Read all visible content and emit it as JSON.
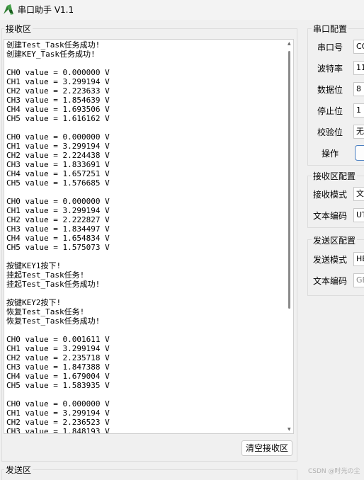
{
  "window": {
    "title": "串口助手 V1.1"
  },
  "receive": {
    "title": "接收区",
    "clear_button": "清空接收区",
    "log_lines": [
      "创建Test_Task任务成功!",
      "创建KEY_Task任务成功!",
      "",
      "CH0 value = 0.000000 V",
      "CH1 value = 3.299194 V",
      "CH2 value = 2.223633 V",
      "CH3 value = 1.854639 V",
      "CH4 value = 1.693506 V",
      "CH5 value = 1.616162 V",
      "",
      "CH0 value = 0.000000 V",
      "CH1 value = 3.299194 V",
      "CH2 value = 2.224438 V",
      "CH3 value = 1.833691 V",
      "CH4 value = 1.657251 V",
      "CH5 value = 1.576685 V",
      "",
      "CH0 value = 0.000000 V",
      "CH1 value = 3.299194 V",
      "CH2 value = 2.222827 V",
      "CH3 value = 1.834497 V",
      "CH4 value = 1.654834 V",
      "CH5 value = 1.575073 V",
      "",
      "按键KEY1按下!",
      "挂起Test_Task任务!",
      "挂起Test_Task任务成功!",
      "",
      "按键KEY2按下!",
      "恢复Test_Task任务!",
      "恢复Test_Task任务成功!",
      "",
      "CH0 value = 0.001611 V",
      "CH1 value = 3.299194 V",
      "CH2 value = 2.235718 V",
      "CH3 value = 1.847388 V",
      "CH4 value = 1.679004 V",
      "CH5 value = 1.583935 V",
      "",
      "CH0 value = 0.000000 V",
      "CH1 value = 3.299194 V",
      "CH2 value = 2.236523 V",
      "CH3 value = 1.848193 V"
    ]
  },
  "send": {
    "title": "发送区"
  },
  "serial_config": {
    "title": "串口配置",
    "port_label": "串口号",
    "port_value": "CO",
    "baud_label": "波特率",
    "baud_value": "11",
    "databits_label": "数据位",
    "databits_value": "8",
    "stopbits_label": "停止位",
    "stopbits_value": "1",
    "parity_label": "校验位",
    "parity_value": "无",
    "operation_label": "操作"
  },
  "receive_config": {
    "title": "接收区配置",
    "mode_label": "接收模式",
    "mode_value": "文",
    "encoding_label": "文本编码",
    "encoding_value": "UT"
  },
  "send_config": {
    "title": "发送区配置",
    "mode_label": "发送模式",
    "mode_value": "HE",
    "encoding_label": "文本编码",
    "encoding_value": "GE"
  },
  "watermark": "CSDN @时光の尘"
}
